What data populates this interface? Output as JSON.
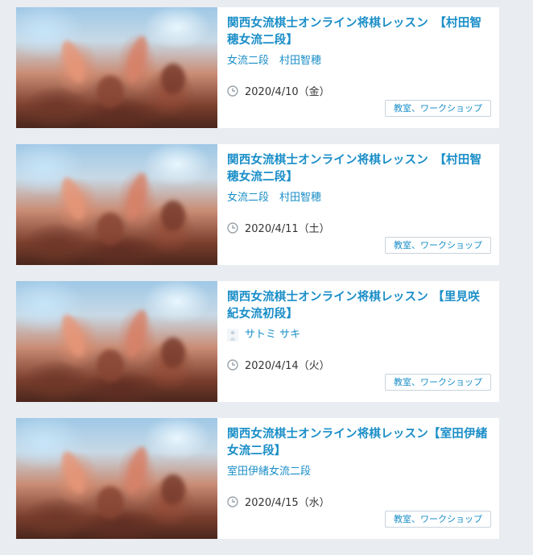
{
  "events": [
    {
      "title": "関西女流棋士オンライン将棋レッスン　【村田智穂女流二段】",
      "author": "女流二段　村田智穂",
      "author_avatar": false,
      "date": "2020/4/10（金）",
      "tag": "教室、ワークショップ"
    },
    {
      "title": "関西女流棋士オンライン将棋レッスン　【村田智穂女流二段】",
      "author": "女流二段　村田智穂",
      "author_avatar": false,
      "date": "2020/4/11（土）",
      "tag": "教室、ワークショップ"
    },
    {
      "title": "関西女流棋士オンライン将棋レッスン 【里見咲紀女流初段】",
      "author": "サトミ サキ",
      "author_avatar": true,
      "date": "2020/4/14（火）",
      "tag": "教室、ワークショップ"
    },
    {
      "title": "関西女流棋士オンライン将棋レッスン【室田伊緒女流二段】",
      "author": "室田伊緒女流二段",
      "author_avatar": false,
      "date": "2020/4/15（水）",
      "tag": "教室、ワークショップ"
    }
  ]
}
